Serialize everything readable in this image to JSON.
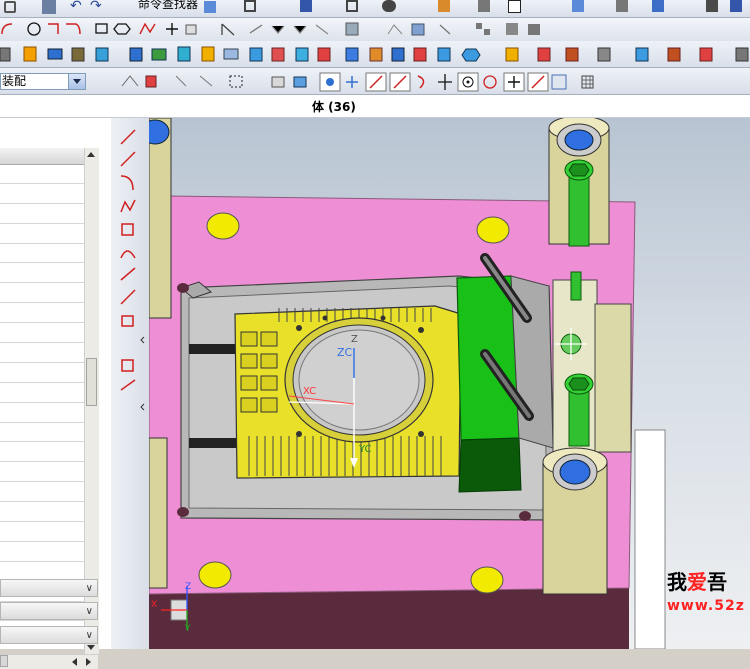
{
  "toolbar": {
    "command_finder_label": "命令查找器",
    "assembly_combo_value": "装配",
    "colors": {
      "accent": "#316ac5",
      "bg": "#d4d0c8"
    }
  },
  "graphics_window": {
    "title": "体 (36)"
  },
  "navigator": {
    "row_count": 25,
    "bottom_bars": [
      "",
      "",
      ""
    ]
  },
  "viewport": {
    "wcs_labels": {
      "zc": "ZC",
      "z": "Z",
      "xc": "XC",
      "yc": "YC"
    },
    "axis_triad": {
      "x": "X",
      "y": "Y",
      "z": "Z"
    },
    "colors": {
      "background": "#c6cfd9",
      "mold_plate": "#ee8fd6",
      "mold_plate_dark": "#5a2b3c",
      "insert": "#b8b8b8",
      "part": "#e9e02a",
      "slide": "#18c018",
      "pillar": "#d9d49c",
      "bushing": "#2f6fe0",
      "bolt": "#30c030"
    }
  },
  "watermark": {
    "line1_a": "我",
    "line1_b": "爱",
    "line1_c": "吾",
    "line2": "www.52z"
  }
}
